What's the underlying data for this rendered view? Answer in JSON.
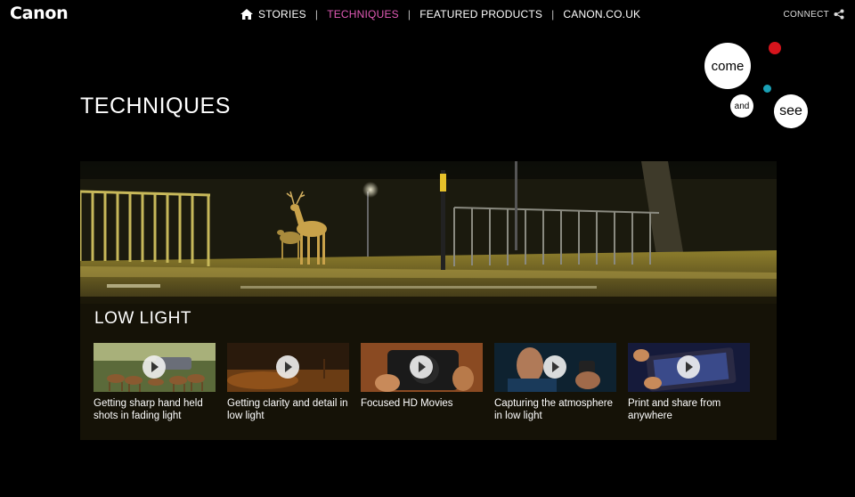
{
  "brand": {
    "logo": "Canon"
  },
  "nav": {
    "items": [
      {
        "label": "STORIES",
        "active": false
      },
      {
        "label": "TECHNIQUES",
        "active": true
      },
      {
        "label": "FEATURED PRODUCTS",
        "active": false
      },
      {
        "label": "CANON.CO.UK",
        "active": false
      }
    ],
    "separator": "|",
    "connect": "CONNECT",
    "active_color": "#e35bb7"
  },
  "badge": {
    "word1": "come",
    "word2": "and",
    "word3": "see"
  },
  "page": {
    "title": "TECHNIQUES"
  },
  "feature": {
    "title": "LOW LIGHT",
    "videos": [
      {
        "caption": "Getting sharp hand held shots in fading light",
        "icon": "play-icon"
      },
      {
        "caption": "Getting clarity and detail in low light",
        "icon": "play-icon"
      },
      {
        "caption": "Focused HD Movies",
        "icon": "play-icon"
      },
      {
        "caption": "Capturing the atmosphere in low light",
        "icon": "play-icon"
      },
      {
        "caption": "Print and share from anywhere",
        "icon": "play-icon"
      }
    ]
  }
}
